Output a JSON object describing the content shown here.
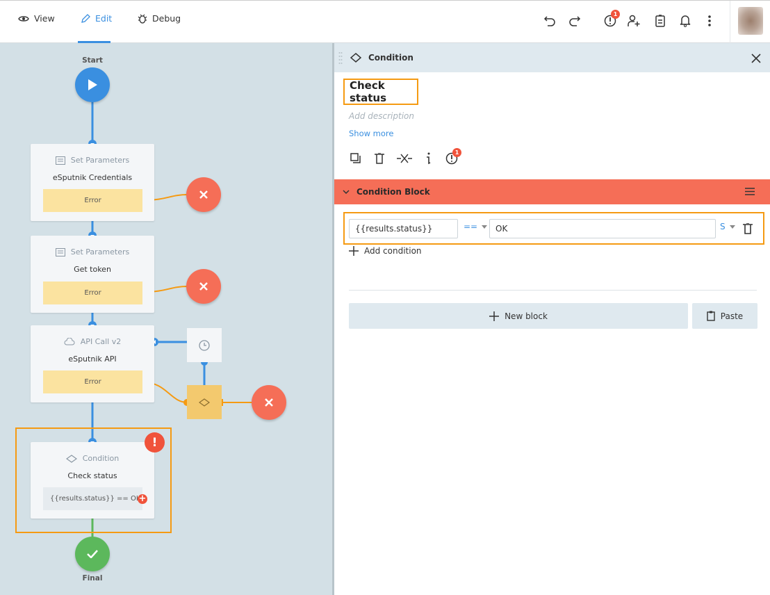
{
  "topbar": {
    "tabs": [
      {
        "label": "View",
        "icon": "eye-icon"
      },
      {
        "label": "Edit",
        "icon": "pencil-icon",
        "active": true
      },
      {
        "label": "Debug",
        "icon": "bug-icon"
      }
    ],
    "actions": [
      "undo-icon",
      "redo-icon",
      "alert-icon",
      "add-user-icon",
      "clipboard-icon",
      "bell-icon",
      "more-icon"
    ],
    "alert_count": "1"
  },
  "canvas": {
    "start_label": "Start",
    "final_label": "Final",
    "nodes": [
      {
        "type": "Set Parameters",
        "title": "eSputnik Credentials",
        "error": "Error"
      },
      {
        "type": "Set Parameters",
        "title": "Get token",
        "error": "Error"
      },
      {
        "type": "API Call v2",
        "title": "eSputnik API",
        "error": "Error"
      },
      {
        "type": "Condition",
        "title": "Check status",
        "expression": "{{results.status}} == OK"
      }
    ]
  },
  "panel": {
    "header": "Condition",
    "title": "Check status",
    "description_placeholder": "Add description",
    "show_more": "Show more",
    "alert_count": "1",
    "block": {
      "title": "Condition Block",
      "left": "{{results.status}}",
      "operator": "==",
      "right": "OK",
      "type": "S",
      "add_condition": "Add condition"
    },
    "new_block": "New block",
    "paste": "Paste"
  },
  "colors": {
    "accent": "#3a8fe0",
    "error": "#f56e57",
    "highlight": "#f59a12",
    "success": "#5cb85c",
    "warning": "#fbe3a0"
  }
}
